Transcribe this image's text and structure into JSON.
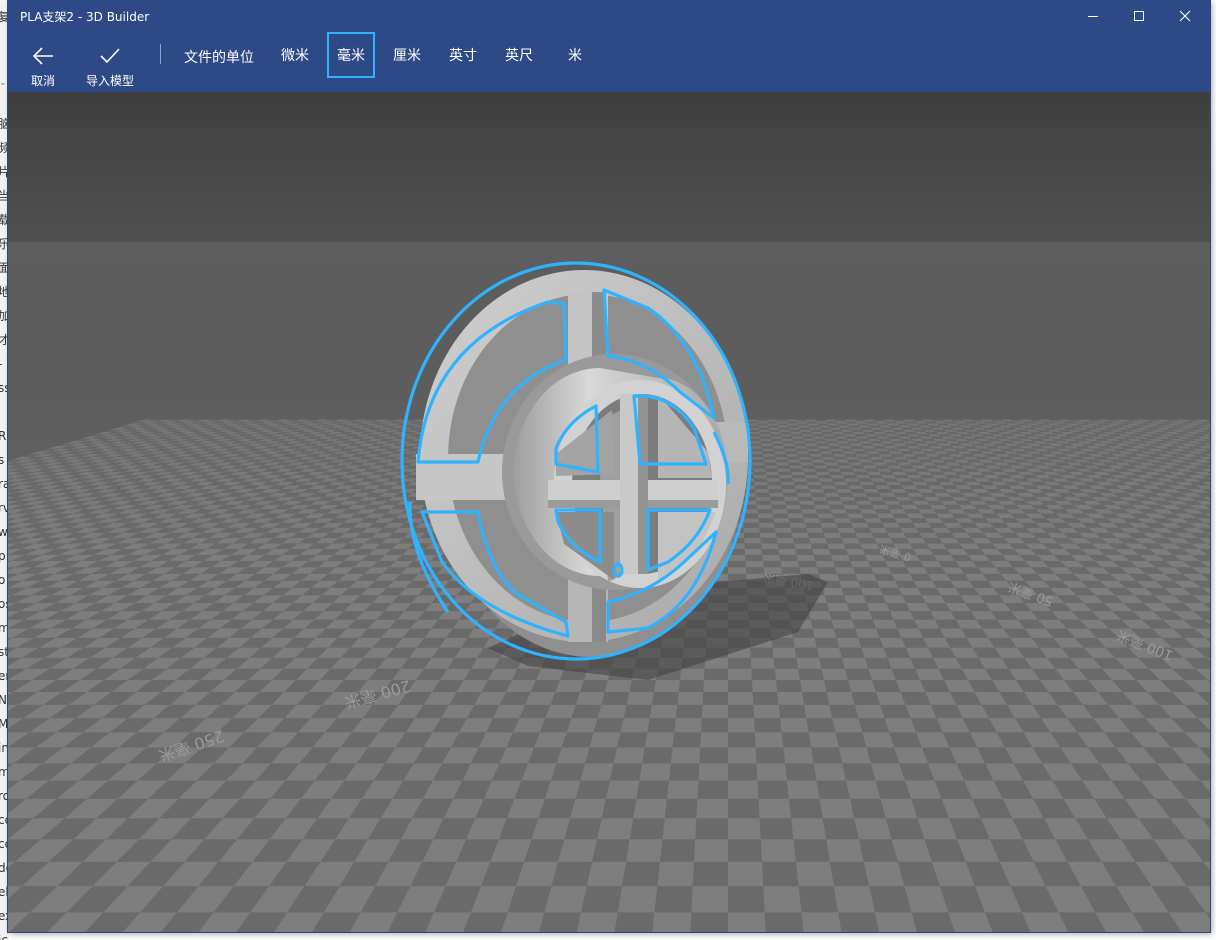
{
  "window": {
    "title": "PLA支架2 - 3D Builder"
  },
  "background_app": {
    "top_char": "复",
    "side_chars": [
      "脑",
      "频",
      "片",
      "当",
      "载",
      "乐",
      "面",
      "地",
      "加",
      "才",
      "-",
      "ss",
      "",
      "R",
      "s",
      "ra",
      "rv",
      "w",
      "p",
      "o",
      "os",
      "m",
      "st",
      "er",
      "N",
      "M",
      "in",
      "m",
      "ro",
      "co",
      "co",
      "de",
      "el",
      "ex",
      "ic"
    ]
  },
  "toolbar": {
    "cancel_label": "取消",
    "import_label": "导入模型",
    "units_title": "文件的单位",
    "units": [
      {
        "label": "微米",
        "selected": false
      },
      {
        "label": "毫米",
        "selected": true
      },
      {
        "label": "厘米",
        "selected": false
      },
      {
        "label": "英寸",
        "selected": false
      },
      {
        "label": "英尺",
        "selected": false
      },
      {
        "label": "米",
        "selected": false
      }
    ]
  },
  "viewport": {
    "grid_labels": [
      "250 毫米",
      "200 毫米",
      "100 毫米",
      "0 毫米",
      "50 毫米",
      "100 毫米"
    ]
  },
  "colors": {
    "accent": "#2fb3ff",
    "toolbar": "#2d4986",
    "model": "#bdbdbd"
  }
}
